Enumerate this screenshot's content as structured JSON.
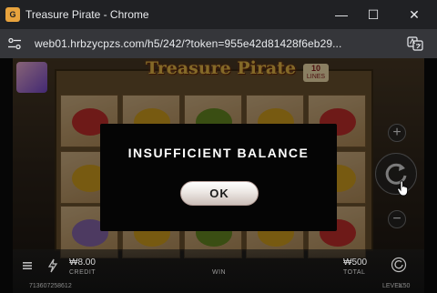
{
  "window": {
    "title": "Treasure Pirate - Chrome",
    "app_icon_text": "G",
    "minimize_glyph": "—",
    "maximize_glyph": "☐",
    "close_glyph": "✕"
  },
  "addressbar": {
    "url": "web01.hrbzycpzs.com/h5/242/?token=955e42d81428f6eb29..."
  },
  "game": {
    "logo": "Treasure Pirate",
    "lines_count": "10",
    "lines_label": "LINES"
  },
  "dialog": {
    "title": "INSUFFICIENT BALANCE",
    "ok_label": "OK"
  },
  "bottom": {
    "credit_value": "₩8.00",
    "credit_label": "CREDIT",
    "win_label": "WIN",
    "total_value": "₩500",
    "total_label": "TOTAL",
    "round_id": "713607258612",
    "level_label": "LEVEL",
    "level_value": "X50"
  },
  "side_buttons": {
    "plus_glyph": "+",
    "minus_glyph": "−"
  },
  "colors": {
    "title_bar": "#202124",
    "address_bar": "#35363a",
    "dialog_bg": "#050505",
    "logo_gold": "#f0c04a"
  }
}
